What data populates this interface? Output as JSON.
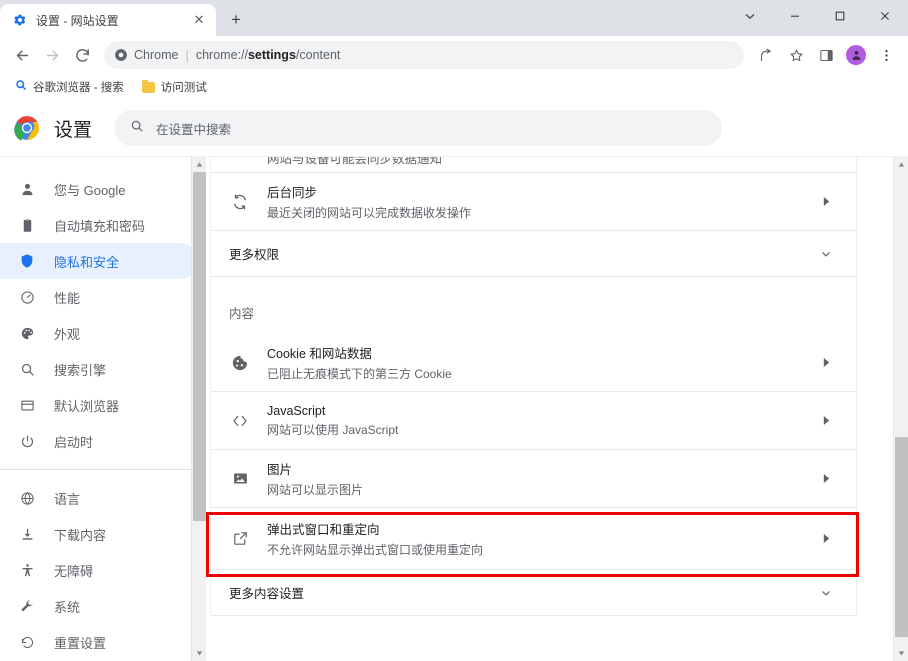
{
  "window": {
    "controls": [
      {
        "name": "chevron-down-icon",
        "glyph": "⌄"
      },
      {
        "name": "minimize-icon",
        "glyph": "—"
      },
      {
        "name": "maximize-icon",
        "glyph": "□"
      },
      {
        "name": "close-icon",
        "glyph": "✕"
      }
    ]
  },
  "tabstrip": {
    "tab_title": "设置 - 网站设置",
    "tab_close_label": "✕",
    "new_tab_label": "+"
  },
  "toolbar": {
    "back_label": "←",
    "forward_label": "→",
    "reload_label": "⟳",
    "security_chip_label": "Chrome",
    "separator": "|",
    "url_prefix": "chrome://",
    "url_bold": "settings",
    "url_suffix": "/content",
    "share_icon": "share-icon",
    "bookmark_icon": "star-icon",
    "sidepanel_icon": "side-panel-icon",
    "profile_icon": "profile-avatar",
    "menu_icon": "three-dot-menu-icon"
  },
  "bookmarks": [
    {
      "label": "谷歌浏览器 - 搜索",
      "icon": "search-icon"
    },
    {
      "label": "访问测试",
      "icon": "folder-icon"
    }
  ],
  "settings_header": {
    "title": "设置",
    "logo": "chrome-logo",
    "search_placeholder": "在设置中搜索",
    "search_icon": "search-icon"
  },
  "sidebar": {
    "groups": [
      {
        "items": [
          {
            "label": "您与 Google",
            "icon": "person-icon",
            "active": false
          },
          {
            "label": "自动填充和密码",
            "icon": "clipboard-icon",
            "active": false
          },
          {
            "label": "隐私和安全",
            "icon": "shield-icon",
            "active": true
          },
          {
            "label": "性能",
            "icon": "gauge-icon",
            "active": false
          },
          {
            "label": "外观",
            "icon": "palette-icon",
            "active": false
          },
          {
            "label": "搜索引擎",
            "icon": "search-icon",
            "active": false
          },
          {
            "label": "默认浏览器",
            "icon": "browser-window-icon",
            "active": false
          },
          {
            "label": "启动时",
            "icon": "power-icon",
            "active": false
          }
        ]
      },
      {
        "items": [
          {
            "label": "语言",
            "icon": "globe-icon",
            "active": false
          },
          {
            "label": "下载内容",
            "icon": "download-icon",
            "active": false
          },
          {
            "label": "无障碍",
            "icon": "accessibility-icon",
            "active": false
          },
          {
            "label": "系统",
            "icon": "wrench-icon",
            "active": false
          },
          {
            "label": "重置设置",
            "icon": "history-restore-icon",
            "active": false
          }
        ]
      }
    ],
    "scrollbar": {
      "up_arrow": "▲",
      "down_arrow": "▼"
    }
  },
  "main": {
    "clipped_row_text": "网站与设备可能会同步数据通知",
    "rows": [
      {
        "type": "setting",
        "icon": "sync-icon",
        "title": "后台同步",
        "subtitle": "最近关闭的网站可以完成数据收发操作",
        "chevron": "›",
        "highlighted": false
      },
      {
        "type": "section",
        "title": "更多权限",
        "chevron": "⌄"
      },
      {
        "type": "group-label",
        "title": "内容"
      },
      {
        "type": "setting",
        "icon": "cookie-icon",
        "title": "Cookie 和网站数据",
        "subtitle": "已阻止无痕模式下的第三方 Cookie",
        "chevron": "›",
        "highlighted": false
      },
      {
        "type": "setting",
        "icon": "code-brackets-icon",
        "title": "JavaScript",
        "subtitle": "网站可以使用 JavaScript",
        "chevron": "›",
        "highlighted": false
      },
      {
        "type": "setting",
        "icon": "image-icon",
        "title": "图片",
        "subtitle": "网站可以显示图片",
        "chevron": "›",
        "highlighted": false
      },
      {
        "type": "setting",
        "icon": "popup-external-link-icon",
        "title": "弹出式窗口和重定向",
        "subtitle": "不允许网站显示弹出式窗口或使用重定向",
        "chevron": "›",
        "highlighted": true
      },
      {
        "type": "section",
        "title": "更多内容设置",
        "chevron": "⌄"
      }
    ],
    "highlight_color": "#ef0000",
    "scrollbar": {
      "up_arrow": "▲",
      "down_arrow": "▼"
    }
  },
  "colors": {
    "accent": "#1a73e8",
    "active_pill": "#e8f0fe",
    "highlight": "#ef0000",
    "avatar": "#b05ce0",
    "tabstrip_bg": "#dee1e6"
  }
}
